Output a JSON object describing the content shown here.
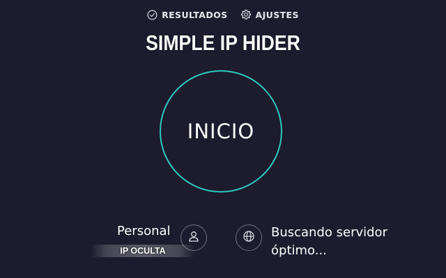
{
  "nav": {
    "results_label": "RESULTADOS",
    "results_icon": "check-circle-icon",
    "settings_label": "AJUSTES",
    "settings_icon": "gear-icon"
  },
  "title": "SIMPLE IP HIDER",
  "start_button": {
    "label": "INICIO",
    "ring_color": "#2fc9c0"
  },
  "profile": {
    "label": "Personal",
    "icon": "user-icon",
    "ip_status": "IP OCULTA"
  },
  "server": {
    "icon": "globe-icon",
    "status": "Buscando servidor óptimo..."
  },
  "colors": {
    "background": "#1c1c2e",
    "accent": "#2fc9c0"
  }
}
